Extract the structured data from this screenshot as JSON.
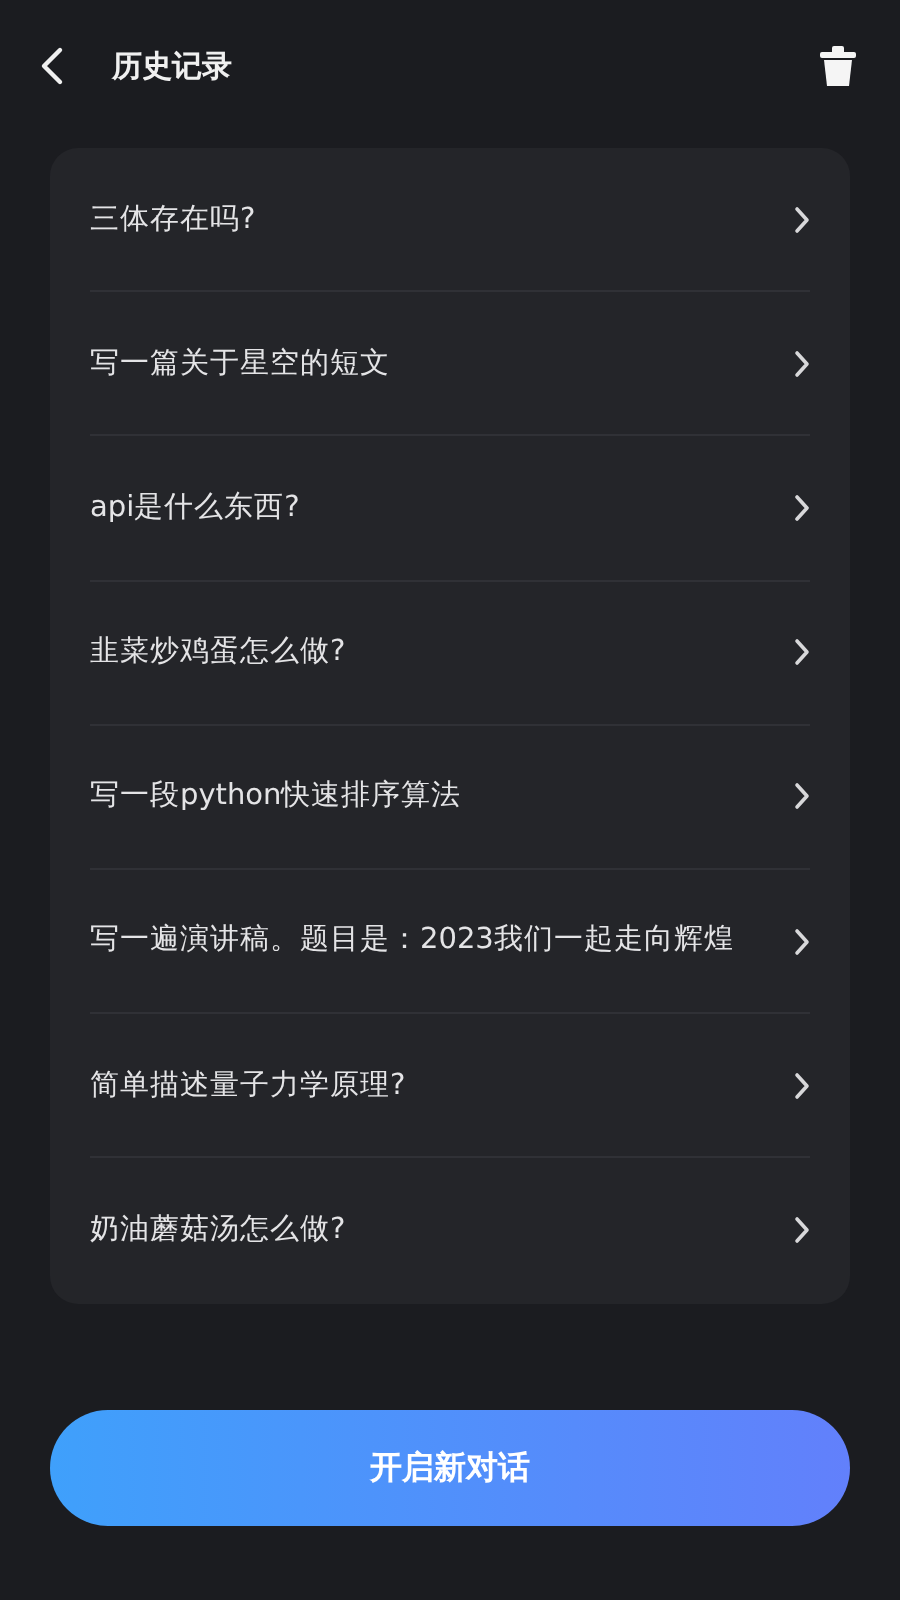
{
  "header": {
    "title": "历史记录"
  },
  "history": [
    {
      "text": "三体存在吗?"
    },
    {
      "text": "写一篇关于星空的短文"
    },
    {
      "text": "api是什么东西?"
    },
    {
      "text": "韭菜炒鸡蛋怎么做?"
    },
    {
      "text": "写一段python快速排序算法"
    },
    {
      "text": "写一遍演讲稿。题目是：2023我们一起走向辉煌"
    },
    {
      "text": "简单描述量子力学原理?"
    },
    {
      "text": "奶油蘑菇汤怎么做?"
    }
  ],
  "button": {
    "label": "开启新对话"
  }
}
